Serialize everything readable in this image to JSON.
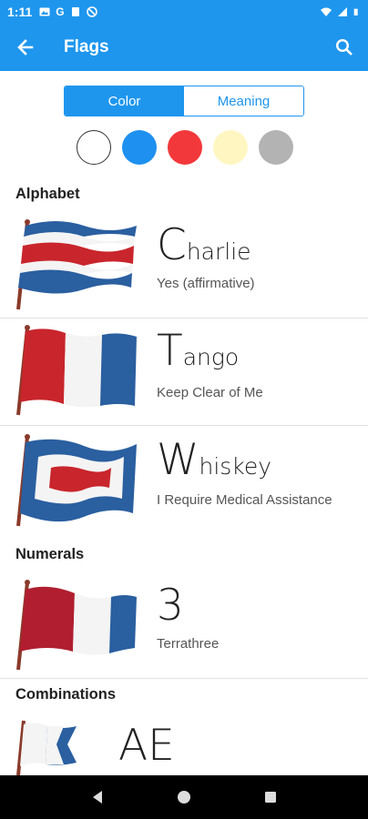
{
  "status_bar": {
    "time": "1:11",
    "notification_glyph": "G",
    "icons": [
      "gallery-icon",
      "g-icon",
      "clipboard-icon",
      "no-disturb-icon",
      "wifi-icon",
      "signal-icon",
      "battery-icon"
    ]
  },
  "app_bar": {
    "title": "Flags",
    "back_icon": "arrow-left-icon",
    "search_icon": "search-icon"
  },
  "toggle": {
    "options": [
      {
        "label": "Color",
        "active": true
      },
      {
        "label": "Meaning",
        "active": false
      }
    ]
  },
  "swatches": [
    {
      "name": "white",
      "color": "#ffffff"
    },
    {
      "name": "blue",
      "color": "#1e90f0"
    },
    {
      "name": "red",
      "color": "#f2383a"
    },
    {
      "name": "yellow",
      "color": "#fff6c2"
    },
    {
      "name": "gray",
      "color": "#b3b3b3"
    }
  ],
  "sections": [
    {
      "title": "Alphabet",
      "items": [
        {
          "initial": "C",
          "rest": "harlie",
          "meaning": "Yes (affirmative)"
        },
        {
          "initial": "T",
          "rest": "ango",
          "meaning": "Keep Clear of Me"
        },
        {
          "initial": "W",
          "rest": "hiskey",
          "meaning": "I Require Medical Assistance"
        }
      ]
    },
    {
      "title": "Numerals",
      "items": [
        {
          "initial": "3",
          "rest": "",
          "meaning": "Terrathree"
        }
      ]
    },
    {
      "title": "Combinations",
      "items": [
        {
          "initial": "AE",
          "rest": "",
          "meaning": ""
        }
      ]
    }
  ],
  "nav_bar": {
    "back": "nav-back-icon",
    "home": "nav-home-icon",
    "recents": "nav-recents-icon"
  },
  "colors": {
    "accent": "#1e96ee",
    "flag_red": "#c9252c",
    "flag_blue": "#2a5fa0",
    "flag_white": "#f4f4f4"
  }
}
